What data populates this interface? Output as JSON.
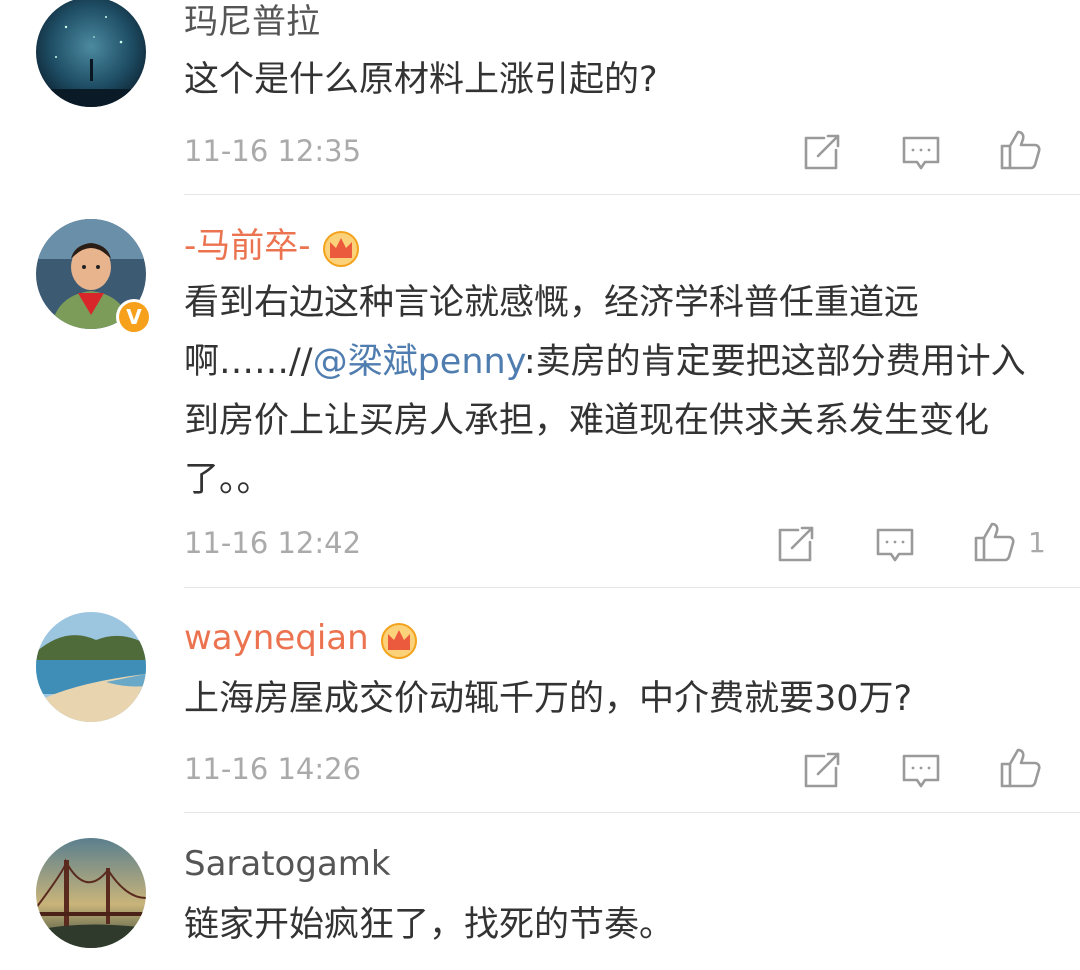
{
  "comments": [
    {
      "username": "玛尼普拉",
      "text": "这个是什么原材料上涨引起的?",
      "time": "11-16 12:35",
      "like_count": ""
    },
    {
      "username": "-马前卒-",
      "text_before": "看到右边这种言论就感慨，经济学科普任重道远啊……//",
      "mention": "@梁斌penny",
      "text_after": ":卖房的肯定要把这部分费用计入到房价上让买房人承担，难道现在供求关系发生变化了。。",
      "time": "11-16 12:42",
      "like_count": "1",
      "verified_badge": "V"
    },
    {
      "username": "wayneqian",
      "text": "上海房屋成交价动辄千万的，中介费就要30万?",
      "time": "11-16 14:26",
      "like_count": ""
    },
    {
      "username": "Saratogamk",
      "text": "链家开始疯狂了，找死的节奏。"
    }
  ],
  "icons": {
    "repost": "repost-icon",
    "comment": "comment-icon",
    "like": "like-icon",
    "crown": "vip-crown-icon"
  },
  "colors": {
    "vip_name": "#eb7350",
    "mention": "#507daf",
    "verified": "#f7a01c",
    "timestamp": "#aaaaaa"
  }
}
